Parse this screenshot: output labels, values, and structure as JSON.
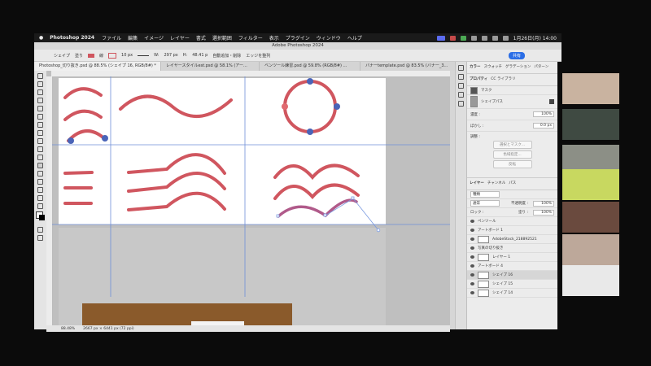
{
  "menubar": {
    "app": "Photoshop 2024",
    "items": [
      "ファイル",
      "編集",
      "イメージ",
      "レイヤー",
      "書式",
      "選択範囲",
      "フィルター",
      "表示",
      "プラグイン",
      "ウィンドウ",
      "ヘルプ"
    ],
    "datetime": "1月26日(月) 14:00"
  },
  "window": {
    "title": "Adobe Photoshop 2024"
  },
  "options": {
    "shape_label": "シェイプ",
    "fill_label": "塗り",
    "stroke_label": "線",
    "stroke_width": "10 px",
    "w_label": "W:",
    "w_value": "297 px",
    "h_label": "H:",
    "h_value": "48.41 p",
    "auto_add": "自動追加・削除",
    "align_edges": "エッジを整列",
    "share": "共有"
  },
  "tabs": [
    {
      "label": "Photoshop_切り抜き.psd @ 88.5% (シェイプ 16, RGB/8#) *",
      "active": true
    },
    {
      "label": "レイヤースタイルest.psd @ 58.1% (アー...",
      "active": false
    },
    {
      "label": "ベンツール練習.psd @ 59.8% (RGB/8#) ...",
      "active": false
    },
    {
      "label": "バナーtemplate.psd @ 83.5% (バナー_3...",
      "active": false
    }
  ],
  "status": {
    "zoom": "88.48%",
    "size": "2667 px × 6441 px (72 ppi)"
  },
  "panel": {
    "top_tabs": [
      "カラー",
      "スウォッチ",
      "グラデーション",
      "パターン"
    ],
    "sub_tabs": [
      "プロパティ",
      "CC ライブラリ"
    ],
    "mask_label": "マスク",
    "shape_path_label": "シェイプパス",
    "density_label": "濃度 :",
    "density_value": "100%",
    "feather_label": "ぼかし :",
    "feather_value": "0.0 px",
    "refine_label": "調整 :",
    "buttons": [
      "選択とマスク...",
      "色域指定...",
      "反転"
    ]
  },
  "layers": {
    "tabs": [
      "レイヤー",
      "チャンネル",
      "パス"
    ],
    "filter": "種類",
    "blend": "通常",
    "opacity_label": "不透明度 :",
    "opacity": "100%",
    "lock_label": "ロック :",
    "fill_label": "塗り :",
    "fill": "100%",
    "rows": [
      {
        "name": "ペンツール",
        "selected": false
      },
      {
        "name": "アートボード 1",
        "selected": false
      },
      {
        "name": "AdobeStock_218892521",
        "selected": false
      },
      {
        "name": "写真の切り抜き",
        "selected": false
      },
      {
        "name": "レイヤー 1",
        "selected": false
      },
      {
        "name": "アートボード 4",
        "selected": false
      },
      {
        "name": "シェイプ 16",
        "selected": true
      },
      {
        "name": "シェイプ 15",
        "selected": false
      },
      {
        "name": "シェイプ 14",
        "selected": false
      }
    ]
  },
  "colors": {
    "curve": "#d0565f",
    "anchor": "#4a64b8",
    "accent": "#2b6ee6"
  }
}
